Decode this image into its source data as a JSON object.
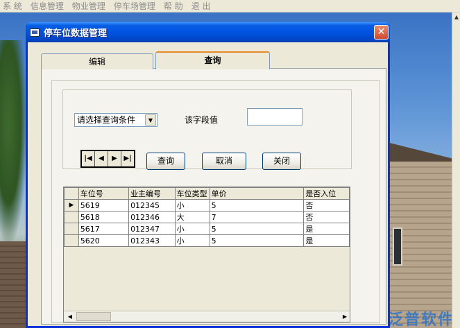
{
  "menubar": {
    "items": [
      "系 统",
      "信息管理",
      "物业管理",
      "停车场管理",
      "帮 助",
      "退 出"
    ]
  },
  "window": {
    "title": "停车位数据管理",
    "close_glyph": "✕"
  },
  "tabs": [
    {
      "label": "编辑",
      "active": false
    },
    {
      "label": "查询",
      "active": true
    }
  ],
  "query": {
    "condition_select": "请选择查询条件",
    "field_value_label": "该字段值",
    "field_value": ""
  },
  "navigation": {
    "first": "|◀",
    "prev": "◀",
    "next": "▶",
    "last": "▶|"
  },
  "buttons": {
    "query": "查询",
    "cancel": "取消",
    "close": "关闭"
  },
  "grid": {
    "columns": [
      "车位号",
      "业主编号",
      "车位类型",
      "单价",
      "是否入位"
    ],
    "rows": [
      [
        "5619",
        "012345",
        "小",
        "5",
        "否"
      ],
      [
        "5618",
        "012346",
        "大",
        "7",
        "否"
      ],
      [
        "5617",
        "012347",
        "小",
        "5",
        "是"
      ],
      [
        "5620",
        "012343",
        "小",
        "5",
        "是"
      ]
    ],
    "current_row_marker": "▶"
  },
  "watermark": "泛普软件",
  "colors": {
    "titlebar": "#0054e3",
    "window_face": "#ece9d8",
    "menu_disabled_text": "#8c8c8c",
    "active_tab_accent": "#e68b2c",
    "close_button": "#d14a2b"
  }
}
